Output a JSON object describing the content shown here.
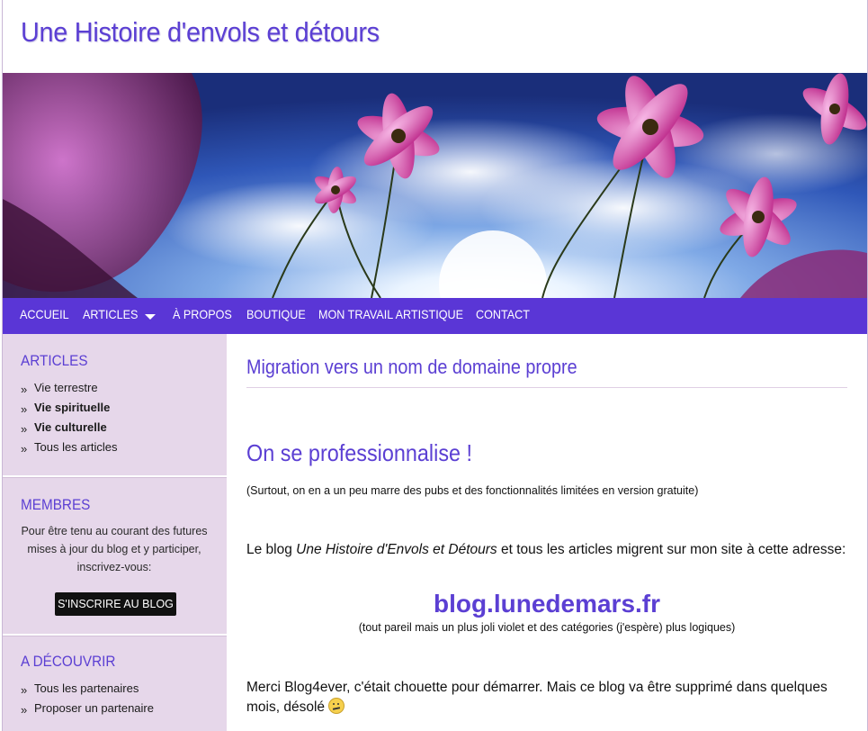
{
  "site": {
    "title": "Une Histoire d'envols et détours"
  },
  "nav": {
    "items": [
      {
        "label": "ACCUEIL"
      },
      {
        "label": "ARTICLES"
      },
      {
        "label": "À PROPOS"
      },
      {
        "label": "BOUTIQUE"
      },
      {
        "label": "MON TRAVAIL ARTISTIQUE"
      },
      {
        "label": "CONTACT"
      }
    ]
  },
  "sidebar": {
    "articles": {
      "title": "ARTICLES",
      "items": [
        {
          "label": "Vie terrestre"
        },
        {
          "label": "Vie spirituelle"
        },
        {
          "label": "Vie culturelle"
        },
        {
          "label": "Tous les articles"
        }
      ]
    },
    "membres": {
      "title": "MEMBRES",
      "text": "Pour être tenu au courant des futures mises à jour du blog et y participer, inscrivez-vous:",
      "button": "S'INSCRIRE AU BLOG"
    },
    "decouvrir": {
      "title": "A DÉCOUVRIR",
      "items": [
        {
          "label": "Tous les partenaires"
        },
        {
          "label": "Proposer un partenaire"
        }
      ]
    }
  },
  "post": {
    "title": "Migration vers un nom de domaine propre",
    "heading": "On se professionnalise !",
    "subnote": "(Surtout, on en a un peu marre des pubs et des fonctionnalités limitées en version gratuite)",
    "para_before": "Le blog ",
    "para_italic": "Une Histoire d'Envols et Détours",
    "para_after": " et tous les articles migrent sur mon site à cette adresse:",
    "link": "blog.lunedemars.fr",
    "link_note": "(tout pareil mais un plus joli violet et des catégories (j'espère) plus logiques)",
    "closing": "Merci Blog4ever, c'était chouette pour démarrer. Mais ce blog va être supprimé dans quelques mois, désolé"
  },
  "colors": {
    "accent": "#5b3fd3",
    "nav_bg": "#5a36d6",
    "sidebar_bg": "#e6d7ea"
  },
  "icons": {
    "nav_dropdown": "caret-down-icon",
    "list_bullet": "double-chevron-right-icon",
    "emoji": "confused-face-icon"
  }
}
